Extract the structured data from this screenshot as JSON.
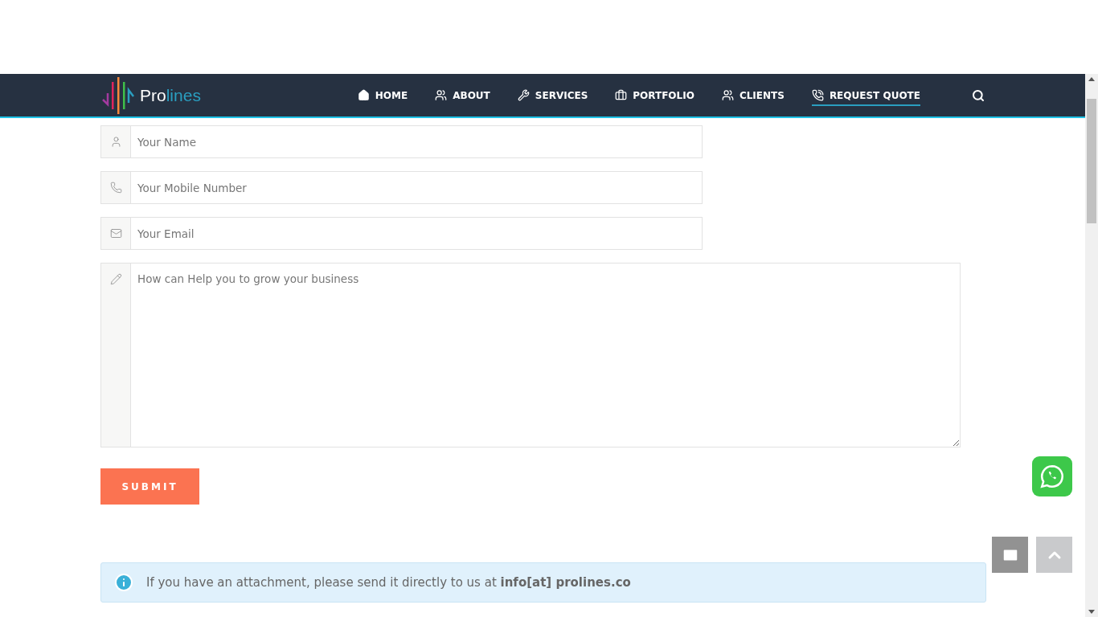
{
  "header": {
    "logo": {
      "part_1": "Pro",
      "part_2": "lines"
    },
    "nav": [
      {
        "label": "HOME",
        "selected": false
      },
      {
        "label": "ABOUT",
        "selected": false
      },
      {
        "label": "SERVICES",
        "selected": false
      },
      {
        "label": "PORTFOLIO",
        "selected": false
      },
      {
        "label": "CLIENTS",
        "selected": false
      },
      {
        "label": "REQUEST QUOTE",
        "selected": true
      }
    ]
  },
  "form": {
    "fields": [
      {
        "kind": "input",
        "placeholder": "Your Name"
      },
      {
        "kind": "input",
        "placeholder": "Your Mobile Number"
      },
      {
        "kind": "input",
        "placeholder": "Your Email"
      },
      {
        "kind": "textarea",
        "placeholder": "How can Help you to grow your business"
      }
    ],
    "submit": "SUBMIT"
  },
  "notice": "If you have an attachment, please send it directly to us at **info[at] prolines.co**"
}
